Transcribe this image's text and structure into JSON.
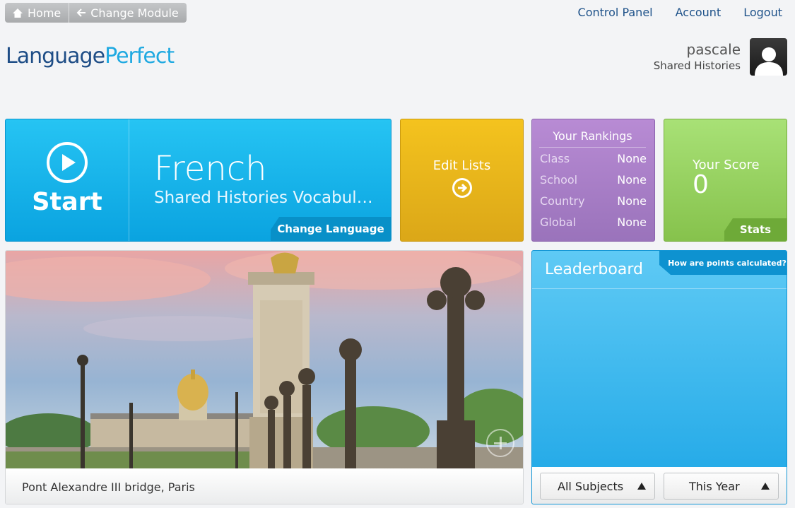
{
  "nav": {
    "home": "Home",
    "change_module": "Change Module"
  },
  "top_links": {
    "control_panel": "Control Panel",
    "account": "Account",
    "logout": "Logout"
  },
  "logo": {
    "part1": "Language",
    "part2": "Perfect"
  },
  "user": {
    "name": "pascale",
    "group": "Shared Histories"
  },
  "start": {
    "label": "Start",
    "language": "French",
    "list": "Shared Histories Vocabulary -...",
    "change_language": "Change Language"
  },
  "edit_lists": {
    "label": "Edit Lists"
  },
  "rankings": {
    "title": "Your Rankings",
    "rows": [
      {
        "label": "Class",
        "value": "None"
      },
      {
        "label": "School",
        "value": "None"
      },
      {
        "label": "Country",
        "value": "None"
      },
      {
        "label": "Global",
        "value": "None"
      }
    ]
  },
  "score": {
    "label": "Your Score",
    "value": "0",
    "stats": "Stats"
  },
  "photo": {
    "caption": "Pont Alexandre III bridge, Paris"
  },
  "leaderboard": {
    "title": "Leaderboard",
    "points_link": "How are points calculated?",
    "subject_filter": "All Subjects",
    "period_filter": "This Year"
  },
  "colors": {
    "start_blue": "#0aa3e0",
    "edit_yellow": "#dba718",
    "rank_purple": "#9a73bb",
    "score_green": "#86c24c",
    "logo_dark": "#1e4d86",
    "logo_light": "#1fa9e1"
  }
}
